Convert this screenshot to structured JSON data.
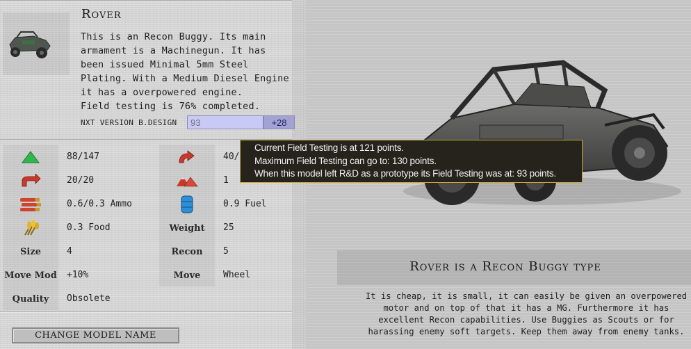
{
  "unit": {
    "name": "Rover",
    "description_lines": [
      "This is an Recon Buggy. Its main",
      "armament is a Machinegun. It has",
      "been issued Minimal 5mm Steel",
      "Plating. With a Medium Diesel Engine",
      "it has a overpowered engine.",
      "Field testing is 76% completed."
    ],
    "version_label": "NXT VERSION B.DESIGN",
    "version_placeholder": "93",
    "version_delta": "+28"
  },
  "stats_left": [
    {
      "key": "",
      "icon": "health-triangle-icon",
      "value": "88/147"
    },
    {
      "key": "",
      "icon": "turn-arrow-icon",
      "value": "20/20"
    },
    {
      "key": "",
      "icon": "ammo-icon",
      "value": "0.6/0.3 Ammo"
    },
    {
      "key": "",
      "icon": "wheat-food-icon",
      "value": "0.3 Food"
    },
    {
      "key": "Size",
      "icon": "",
      "value": "4"
    },
    {
      "key": "Move Mod",
      "icon": "",
      "value": "+10%"
    },
    {
      "key": "Quality",
      "icon": "",
      "value": "Obsolete"
    }
  ],
  "stats_right": [
    {
      "key": "",
      "icon": "curved-arrow-icon",
      "value": "40/"
    },
    {
      "key": "",
      "icon": "mountain-icon",
      "value": "1"
    },
    {
      "key": "",
      "icon": "fuel-barrel-icon",
      "value": "0.9 Fuel"
    },
    {
      "key": "Weight",
      "icon": "",
      "value": "25"
    },
    {
      "key": "Recon",
      "icon": "",
      "value": "5"
    },
    {
      "key": "Move",
      "icon": "",
      "value": "Wheel"
    }
  ],
  "change_model_button": "CHANGE MODEL NAME",
  "type_panel": {
    "title": "Rover is a Recon Buggy type",
    "description_lines": [
      "It is cheap, it is small, it can easily be given an overpowered",
      "motor and on top of that it has a MG. Furthermore it has",
      "excellent Recon capabilities. Use Buggies as Scouts or for",
      "harassing enemy soft targets. Keep them away from enemy tanks."
    ]
  },
  "tooltip": {
    "lines": [
      "Current Field Testing is at 121 points.",
      "Maximum Field Testing can go to: 130 points.",
      "When this model left R&D as a prototype its Field Testing was at: 93 points."
    ]
  },
  "colors": {
    "tooltip_bg": "#25231b",
    "tooltip_border": "#c9a63a",
    "input_bg": "#c9c9f6",
    "delta_bg": "#a2a2d3",
    "health_green": "#2db84a",
    "turn_red": "#c8392c"
  }
}
